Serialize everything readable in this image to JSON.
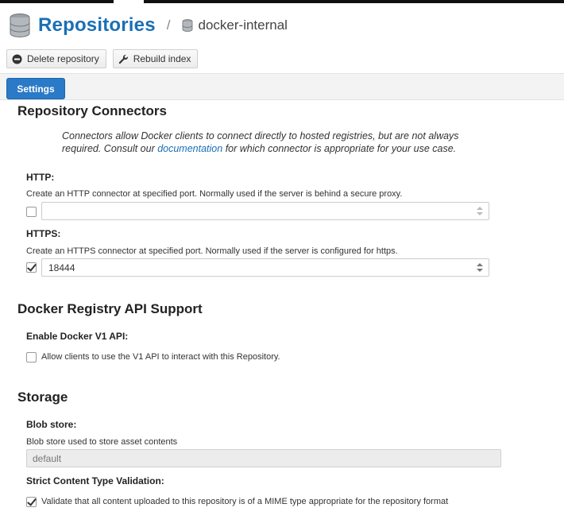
{
  "header": {
    "title": "Repositories",
    "separator": "/",
    "repository_name": "docker-internal"
  },
  "toolbar": {
    "delete_label": "Delete repository",
    "rebuild_label": "Rebuild index"
  },
  "tabs": [
    {
      "label": "Settings",
      "active": true
    }
  ],
  "connectors": {
    "heading": "Repository Connectors",
    "description_pre": "Connectors allow Docker clients to connect directly to hosted registries, but are not always required. Consult our ",
    "description_link": "documentation",
    "description_post": " for which connector is appropriate for your use case.",
    "http": {
      "label": "HTTP:",
      "help": "Create an HTTP connector at specified port. Normally used if the server is behind a secure proxy.",
      "enabled": false,
      "value": ""
    },
    "https": {
      "label": "HTTPS:",
      "help": "Create an HTTPS connector at specified port. Normally used if the server is configured for https.",
      "enabled": true,
      "value": "18444"
    }
  },
  "api_support": {
    "heading": "Docker Registry API Support",
    "v1_label": "Enable Docker V1 API:",
    "v1_checkbox_text": "Allow clients to use the V1 API to interact with this Repository.",
    "v1_enabled": false
  },
  "storage": {
    "heading": "Storage",
    "blob_label": "Blob store:",
    "blob_help": "Blob store used to store asset contents",
    "blob_value": "default",
    "strict_label": "Strict Content Type Validation:",
    "strict_checkbox_text": "Validate that all content uploaded to this repository is of a MIME type appropriate for the repository format",
    "strict_enabled": true
  },
  "colors": {
    "accent": "#1b6fb5",
    "tab_active": "#2a7ac8"
  },
  "icons": {
    "title_icon": "database-icon",
    "breadcrumb_icon": "database-icon",
    "delete_icon": "minus-circle-icon",
    "rebuild_icon": "wrench-icon"
  }
}
